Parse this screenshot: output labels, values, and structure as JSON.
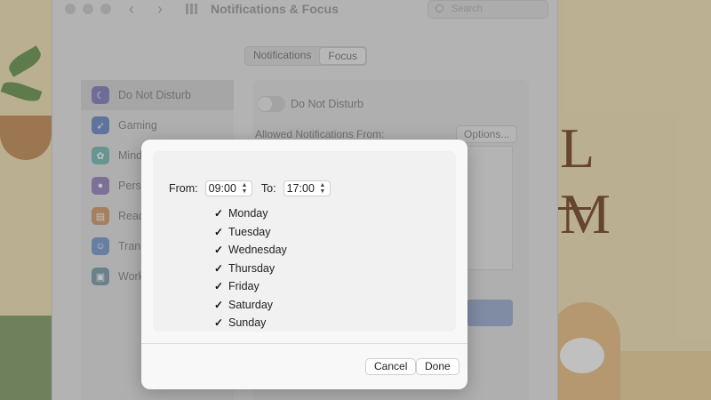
{
  "window": {
    "title": "Notifications & Focus",
    "search_placeholder": "Search"
  },
  "tabs": [
    {
      "label": "Notifications",
      "active": false
    },
    {
      "label": "Focus",
      "active": true
    }
  ],
  "sidebar": {
    "items": [
      {
        "label": "Do Not Disturb",
        "icon": "moon-icon",
        "color": "#8a84c8",
        "glyph": "☾"
      },
      {
        "label": "Gaming",
        "icon": "rocket-icon",
        "color": "#6f8fcf",
        "glyph": "➶"
      },
      {
        "label": "Mind",
        "icon": "flower-icon",
        "color": "#7cc0b8",
        "glyph": "✿"
      },
      {
        "label": "Perso",
        "icon": "person-icon",
        "color": "#9b88c4",
        "glyph": "●"
      },
      {
        "label": "Read",
        "icon": "book-icon",
        "color": "#d9a070",
        "glyph": "▤"
      },
      {
        "label": "Trang",
        "icon": "smile-icon",
        "color": "#7d9fd2",
        "glyph": "☺"
      },
      {
        "label": "Work",
        "icon": "badge-icon",
        "color": "#7fa2b0",
        "glyph": "▣"
      }
    ]
  },
  "content": {
    "dnd_label": "Do Not Disturb",
    "allowed_label": "Allowed Notifications From:",
    "options_label": "Options..."
  },
  "sheet": {
    "from_label": "From:",
    "from_value": "09:00",
    "to_label": "To:",
    "to_value": "17:00",
    "days": [
      {
        "label": "Monday",
        "checked": true
      },
      {
        "label": "Tuesday",
        "checked": true
      },
      {
        "label": "Wednesday",
        "checked": true
      },
      {
        "label": "Thursday",
        "checked": true
      },
      {
        "label": "Friday",
        "checked": true
      },
      {
        "label": "Saturday",
        "checked": true
      },
      {
        "label": "Sunday",
        "checked": true
      }
    ],
    "cancel_label": "Cancel",
    "done_label": "Done"
  },
  "wallpaper": {
    "letters": "L M"
  }
}
